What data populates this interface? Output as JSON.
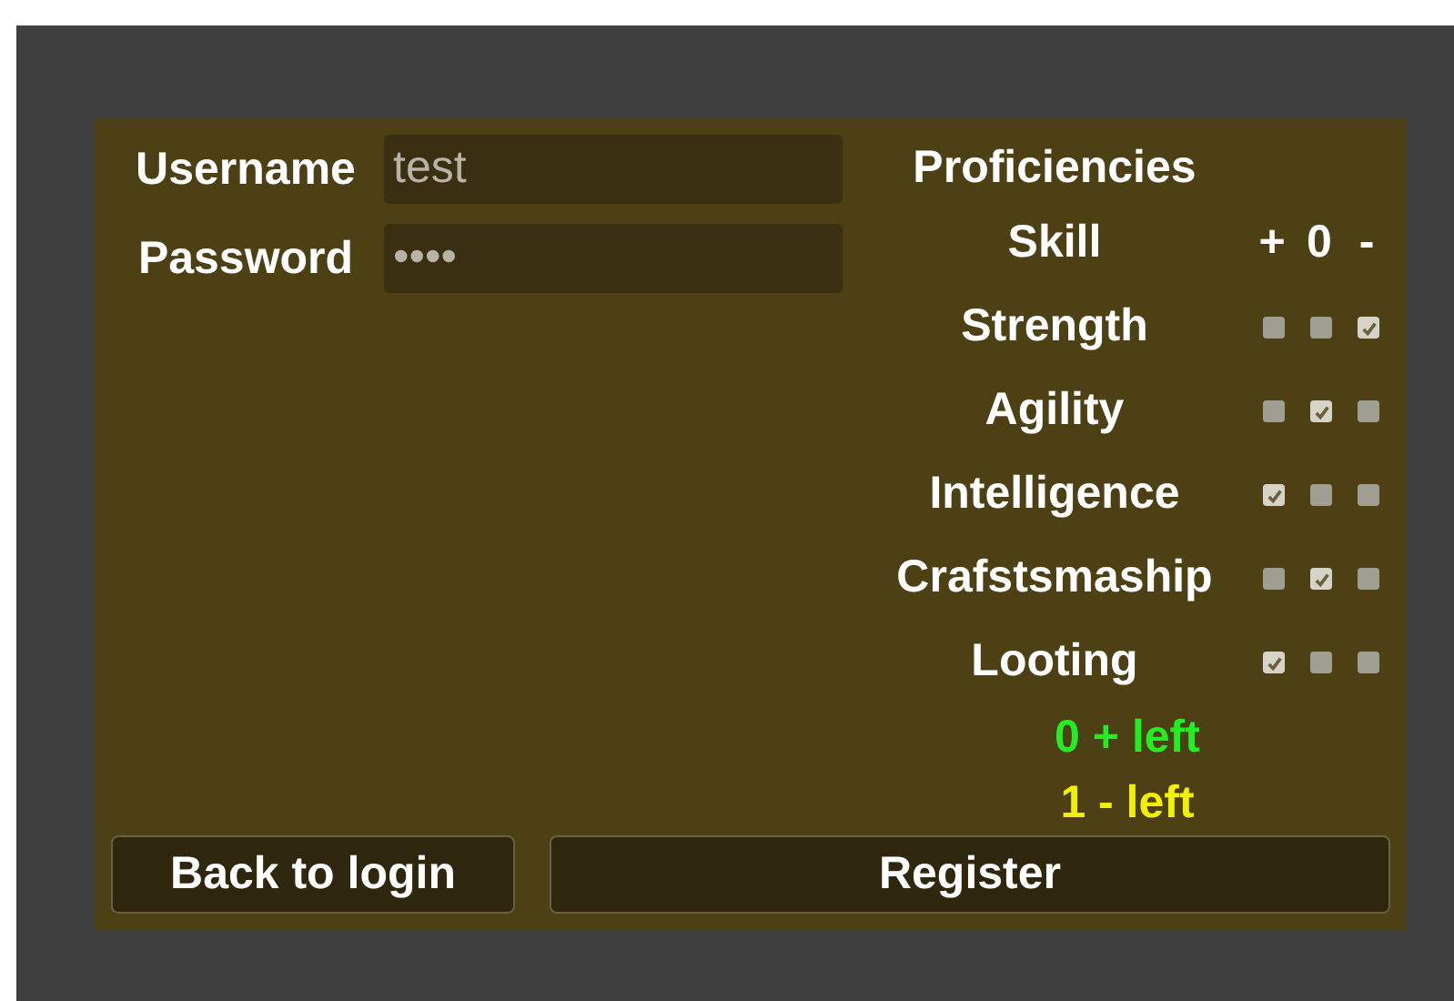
{
  "form": {
    "username": {
      "label": "Username",
      "value": "test"
    },
    "password": {
      "label": "Password",
      "value": "••••"
    }
  },
  "proficiencies": {
    "title": "Proficiencies",
    "header": {
      "label": "Skill",
      "columns": [
        "+",
        "0",
        "-"
      ]
    },
    "skills": [
      {
        "name": "Strength",
        "options": [
          {
            "checked": false
          },
          {
            "checked": false
          },
          {
            "checked": true
          }
        ]
      },
      {
        "name": "Agility",
        "options": [
          {
            "checked": false
          },
          {
            "checked": true
          },
          {
            "checked": false
          }
        ]
      },
      {
        "name": "Intelligence",
        "options": [
          {
            "checked": true
          },
          {
            "checked": false
          },
          {
            "checked": false
          }
        ]
      },
      {
        "name": "Crafstsmaship",
        "options": [
          {
            "checked": false
          },
          {
            "checked": true
          },
          {
            "checked": false
          }
        ]
      },
      {
        "name": "Looting",
        "options": [
          {
            "checked": true
          },
          {
            "checked": false
          },
          {
            "checked": false
          }
        ]
      }
    ],
    "counters": [
      {
        "text": "0 + left",
        "color": "#22ee22"
      },
      {
        "text": "1 - left",
        "color": "#f0f000"
      }
    ]
  },
  "buttons": [
    {
      "label": "Back to login",
      "kind": "back"
    },
    {
      "label": "Register",
      "kind": "primary"
    }
  ]
}
